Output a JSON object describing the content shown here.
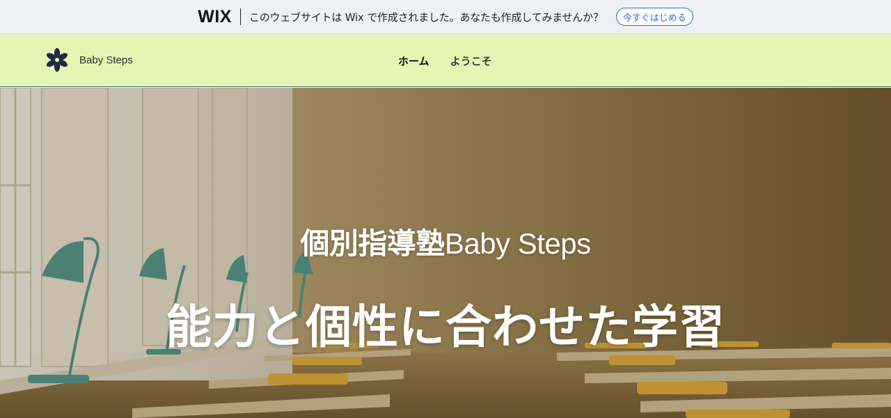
{
  "wix_banner": {
    "logo": "WIX",
    "message": "このウェブサイトは Wix で作成されました。あなたも作成してみませんか？",
    "cta_label": "今すぐはじめる",
    "accent_color": "#2e6ad8"
  },
  "header": {
    "brand_name": "Baby Steps",
    "brand_icon": "flower-icon",
    "background_color": "#e5f5b3",
    "nav": [
      {
        "label": "ホーム",
        "active": true
      },
      {
        "label": "ようこそ",
        "active": false
      }
    ]
  },
  "hero": {
    "subtitle_jp": "個別指導塾",
    "subtitle_en": "Baby Steps",
    "title": "能力と個性に合わせた学習",
    "image": "classroom-photo"
  }
}
